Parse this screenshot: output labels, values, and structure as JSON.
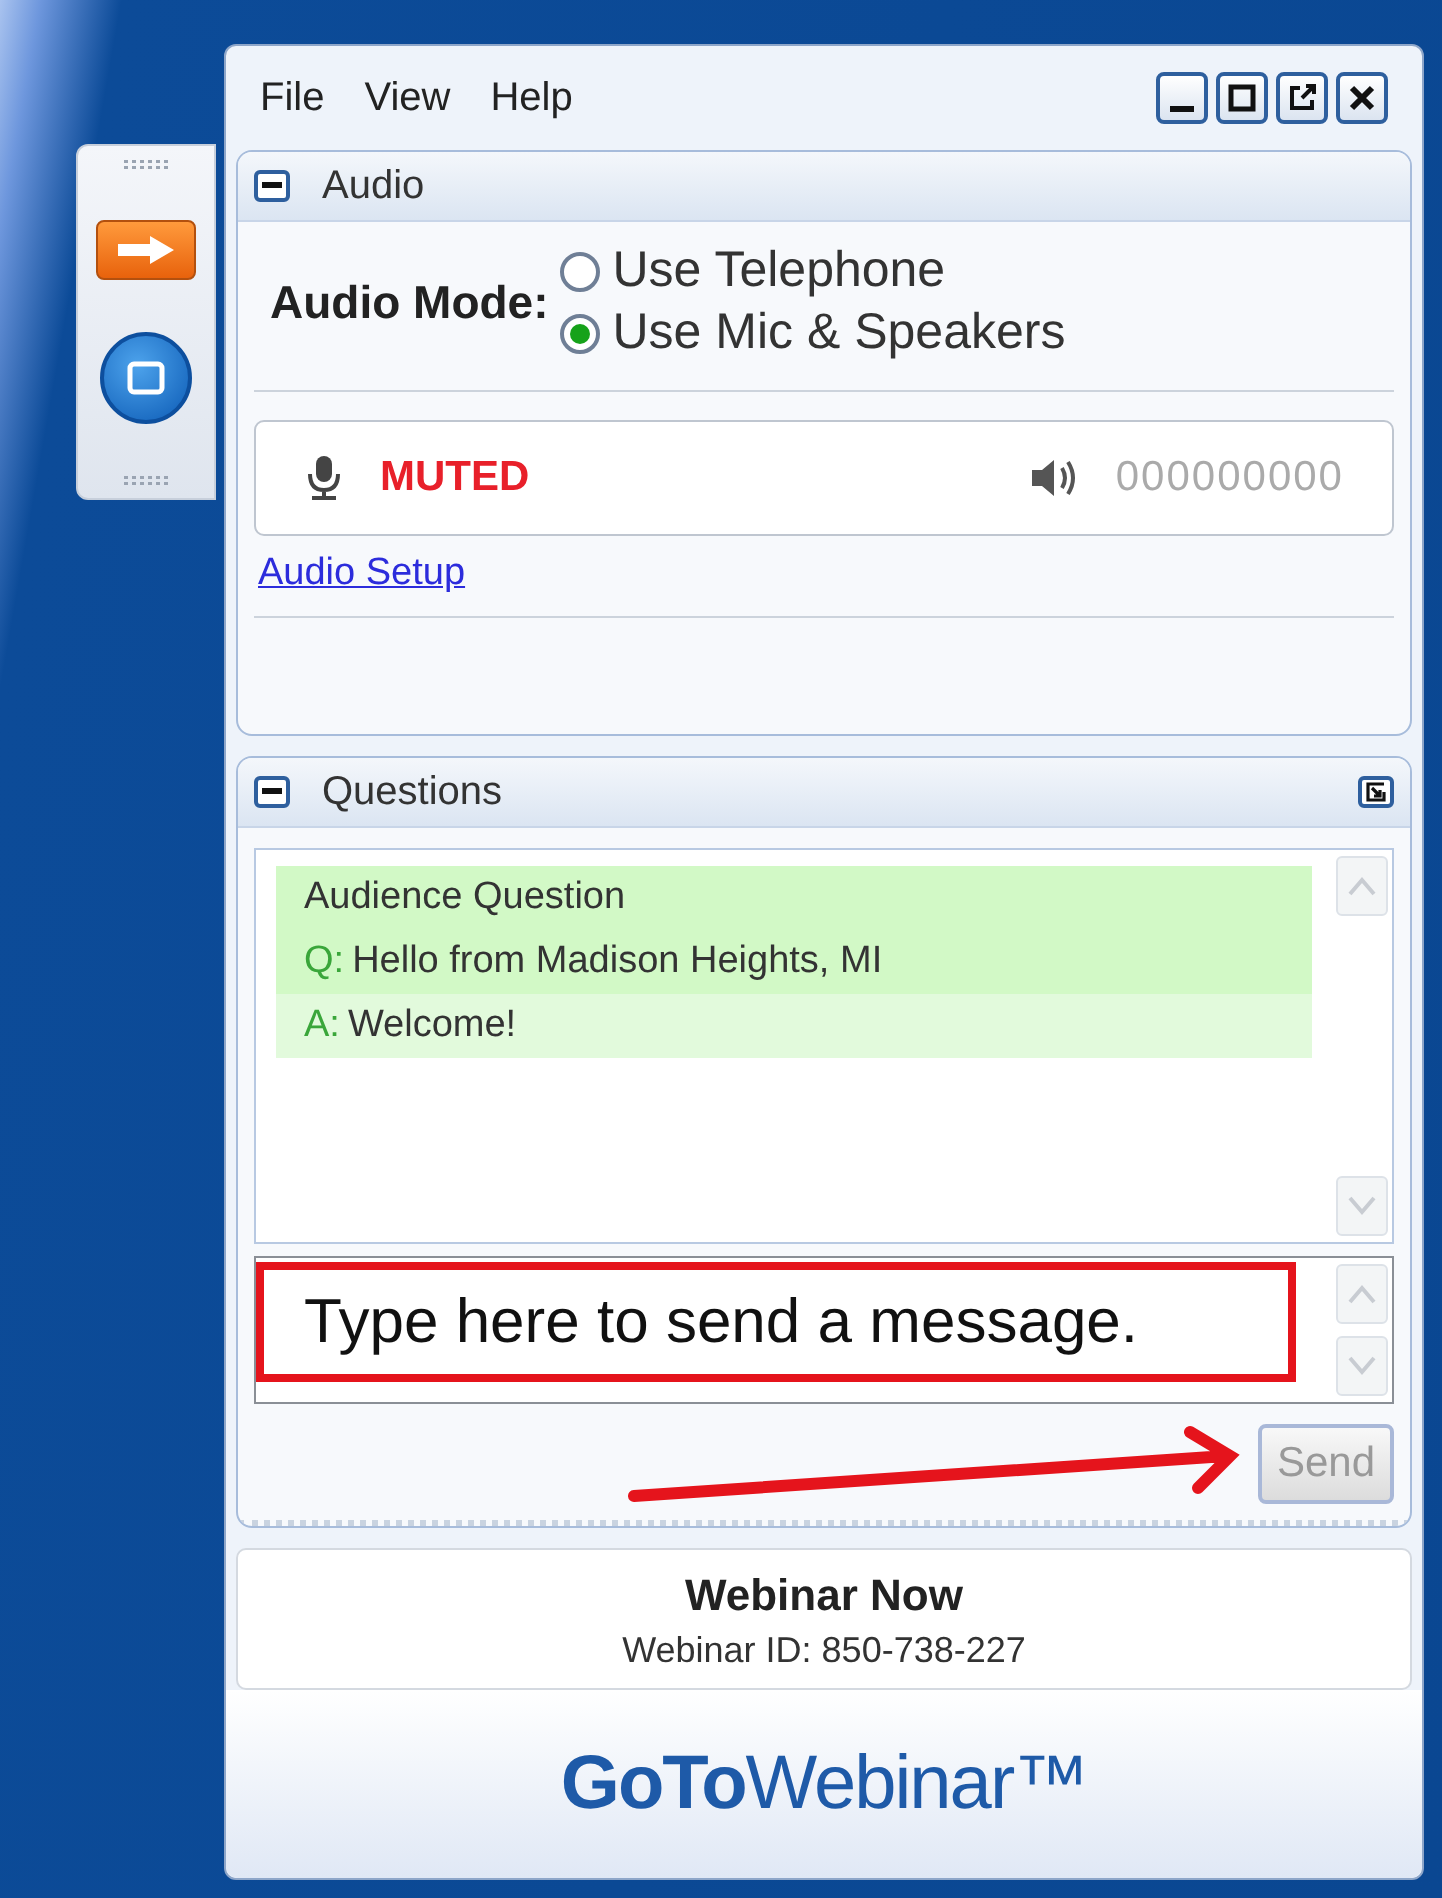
{
  "menu": [
    "File",
    "View",
    "Help"
  ],
  "audio": {
    "title": "Audio",
    "mode_label": "Audio Mode:",
    "options": [
      {
        "label": "Use Telephone",
        "selected": false
      },
      {
        "label": "Use Mic & Speakers",
        "selected": true
      }
    ],
    "mic_status": "MUTED",
    "speaker_reading": "000000000",
    "setup_link": "Audio Setup"
  },
  "questions": {
    "title": "Questions",
    "entries": [
      {
        "kind": "title",
        "text": "Audience Question"
      },
      {
        "kind": "question",
        "prefix": "Q:",
        "text": "Hello from Madison Heights, MI"
      },
      {
        "kind": "answer",
        "prefix": "A:",
        "text": "Welcome!"
      }
    ],
    "message": {
      "placeholder": "Type here to send a message."
    },
    "send": {
      "label": "Send",
      "disabled": true
    }
  },
  "info": {
    "title": "Webinar Now",
    "webinar_id": "Webinar ID: 850-738-227"
  },
  "logo": "**GoTo**Webinar™"
}
